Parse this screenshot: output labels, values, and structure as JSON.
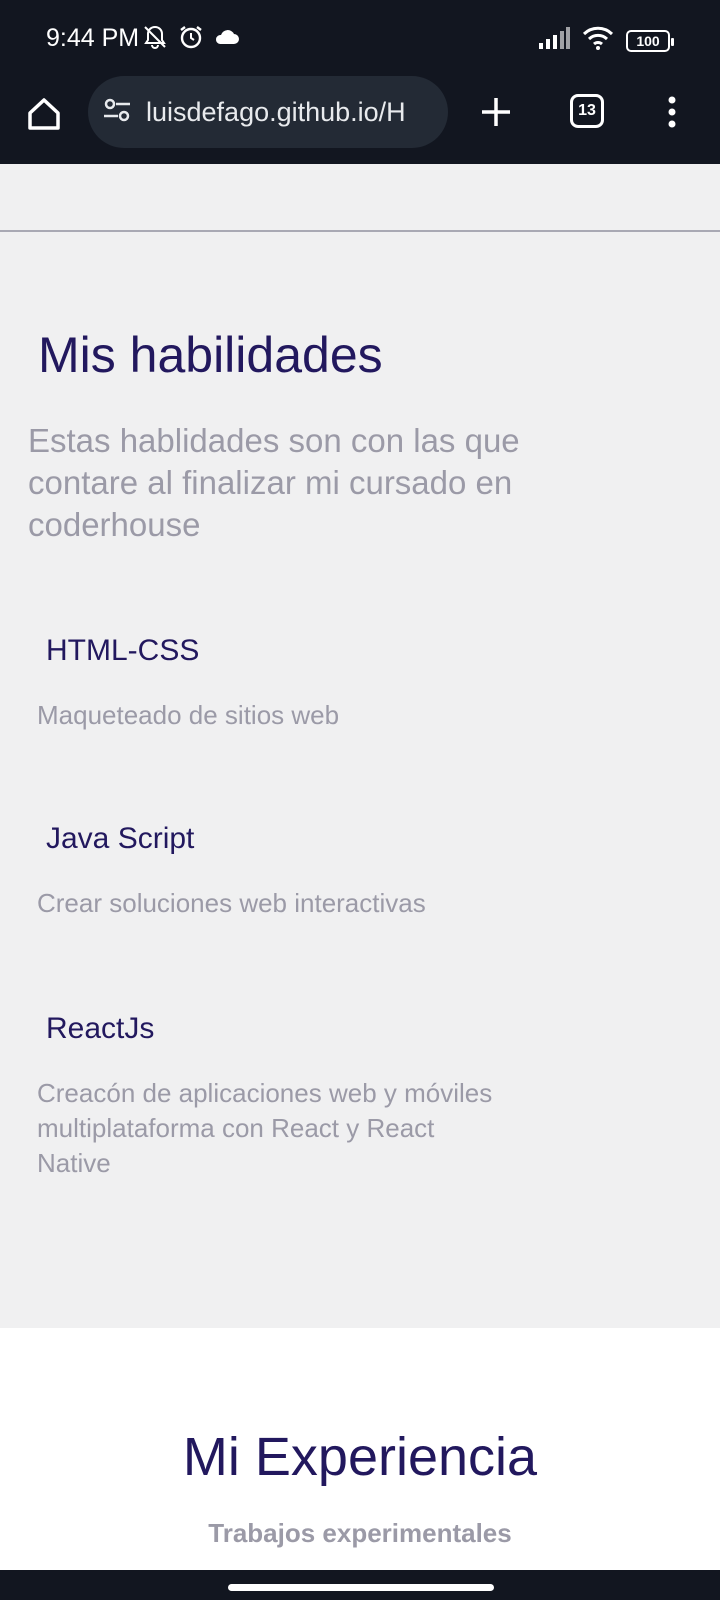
{
  "status_bar": {
    "time": "9:44 PM",
    "battery": "100",
    "icons": [
      "bell-off-icon",
      "alarm-icon",
      "cloud-icon",
      "signal-icon",
      "wifi-icon",
      "battery-icon"
    ]
  },
  "browser": {
    "url": "luisdefago.github.io/H",
    "tab_count": "13"
  },
  "skills": {
    "title": "Mis habilidades",
    "subtitle": "Estas hablidades son con las que contare al finalizar mi cursado en coderhouse",
    "items": [
      {
        "name": "HTML-CSS",
        "desc": "Maqueteado de sitios web"
      },
      {
        "name": "Java Script",
        "desc": "Crear soluciones web interactivas"
      },
      {
        "name": "ReactJs",
        "desc": "Creacón de aplicaciones web y móviles multiplataforma con React y React Native"
      }
    ]
  },
  "experience": {
    "title": "Mi Experiencia",
    "subtitle": "Trabajos experimentales"
  },
  "colors": {
    "heading": "#22185e",
    "muted": "#9b9aa7",
    "page_bg": "#f0f0f1",
    "chrome_bg": "#121620"
  }
}
